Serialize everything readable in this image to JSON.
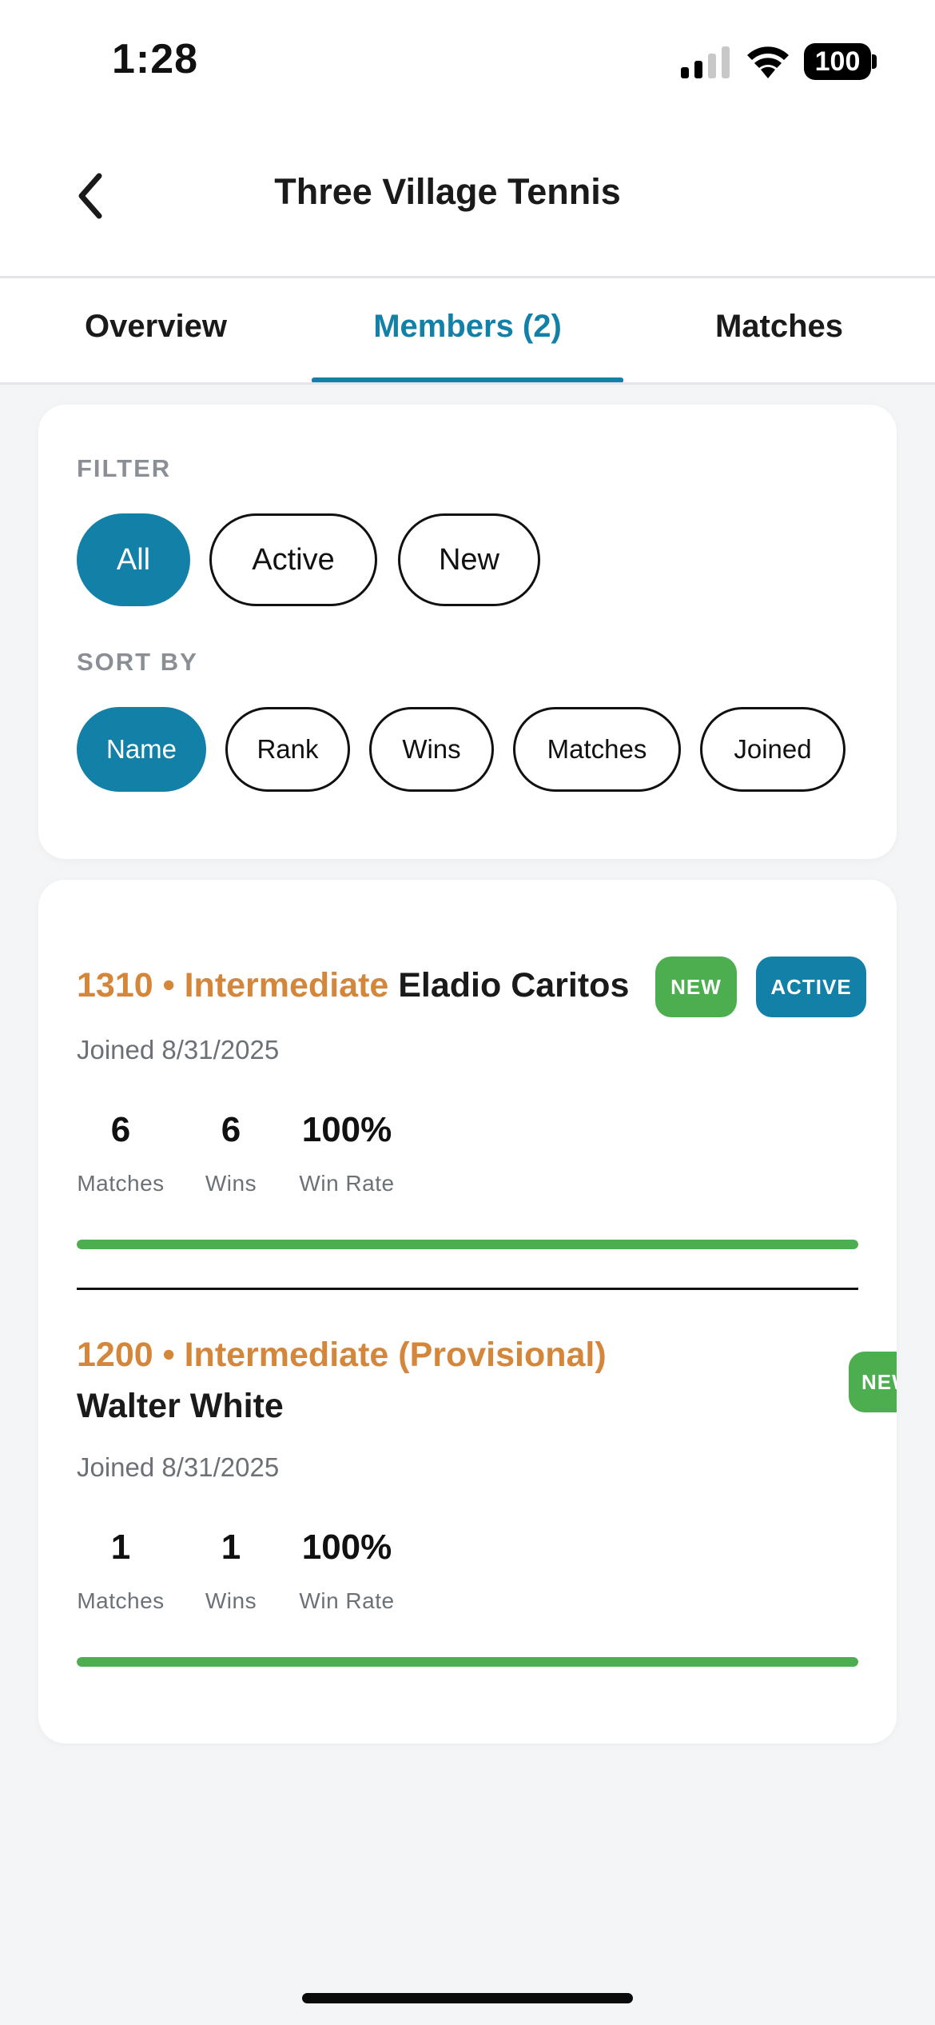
{
  "status_bar": {
    "time": "1:28",
    "battery": "100"
  },
  "header": {
    "title": "Three Village Tennis"
  },
  "tabs": [
    {
      "label": "Overview"
    },
    {
      "label": "Members (2)"
    },
    {
      "label": "Matches"
    }
  ],
  "filter": {
    "label": "FILTER",
    "options": [
      "All",
      "Active",
      "New"
    ],
    "selected": "All"
  },
  "sort": {
    "label": "SORT BY",
    "options": [
      "Name",
      "Rank",
      "Wins",
      "Matches",
      "Joined"
    ],
    "selected": "Name"
  },
  "members": [
    {
      "rank_text": "1310 • Intermediate",
      "name": "Eladio Caritos",
      "badges": [
        "NEW",
        "ACTIVE"
      ],
      "joined": "Joined 8/31/2025",
      "stats": {
        "matches": "6",
        "wins": "6",
        "win_rate": "100%"
      },
      "win_rate_fraction": 1.0
    },
    {
      "rank_text": "1200 • Intermediate (Provisional)",
      "name": "Walter White",
      "badges": [
        "NEW"
      ],
      "joined": "Joined 8/31/2025",
      "stats": {
        "matches": "1",
        "wins": "1",
        "win_rate": "100%"
      },
      "win_rate_fraction": 1.0
    }
  ],
  "stat_labels": {
    "matches": "Matches",
    "wins": "Wins",
    "win_rate": "Win Rate"
  },
  "colors": {
    "accent": "#1380a8",
    "rank": "#d4863a",
    "success": "#4cae4f"
  }
}
